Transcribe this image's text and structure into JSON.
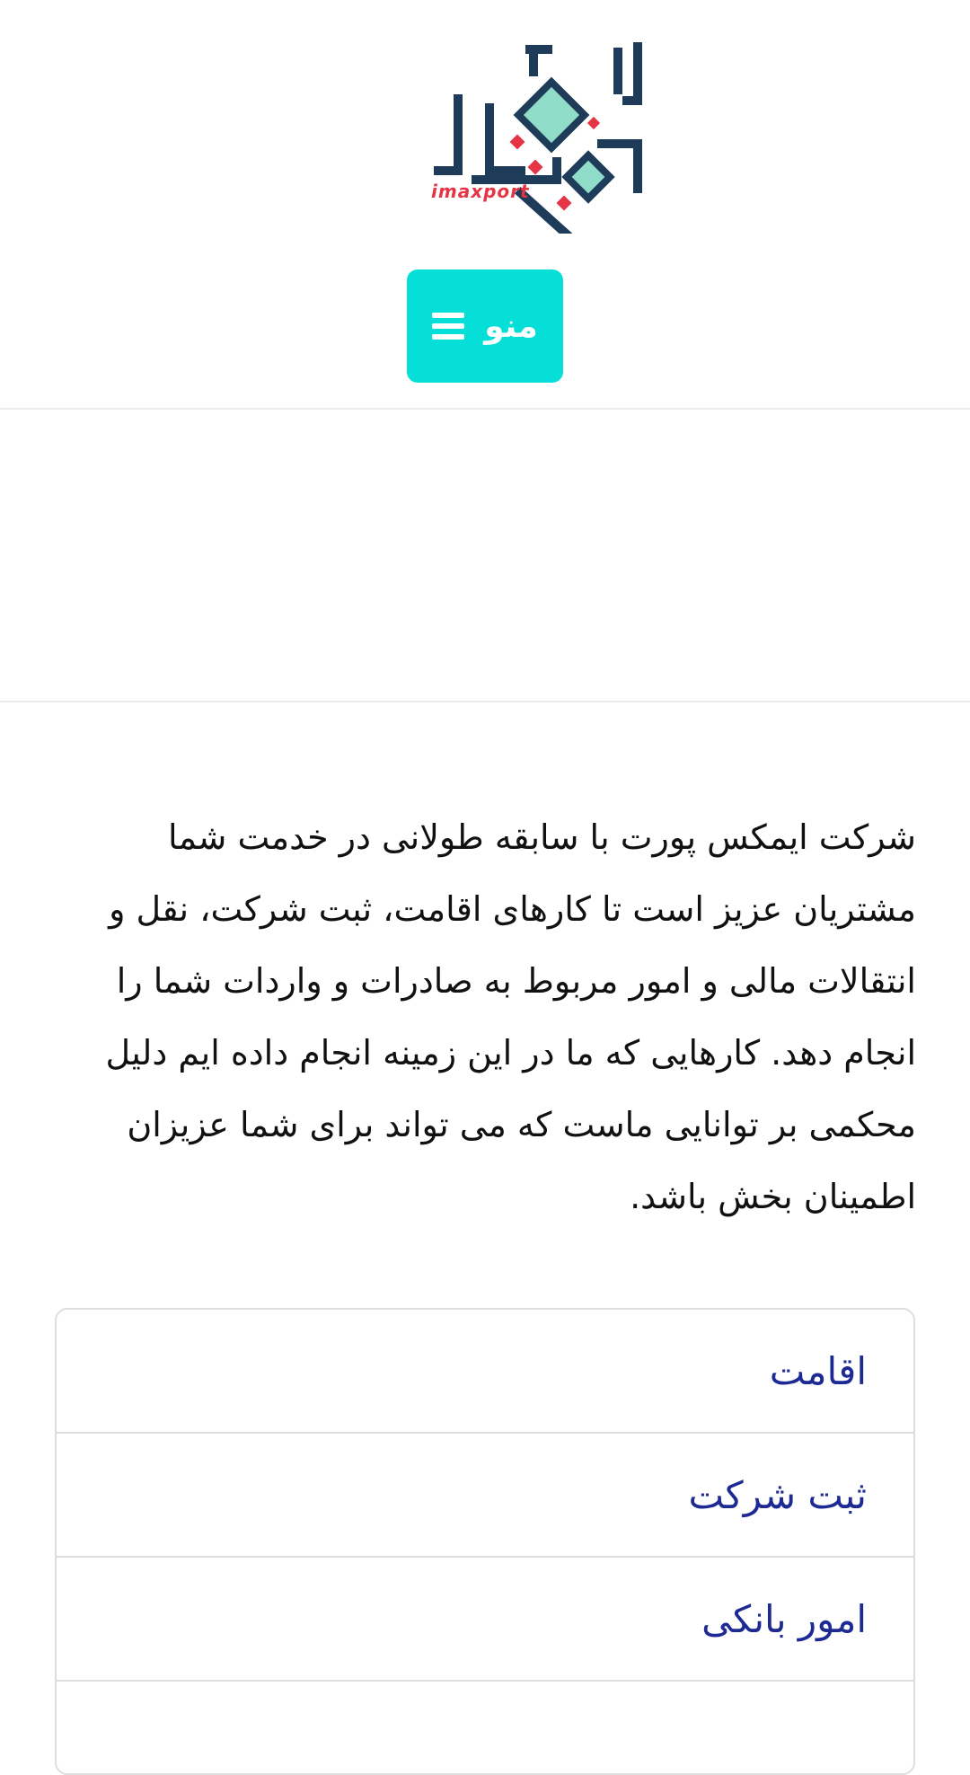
{
  "header": {
    "logo_caption": "imaxport",
    "menu_label": "منو"
  },
  "intro": {
    "text": "شرکت ایمکس پورت با سابقه طولانی در خدمت شما مشتریان عزیز است تا کارهای اقامت، ثبت شرکت، نقل و انتقالات مالی و امور مربوط به صادرات و واردات شما را انجام دهد. کارهایی که ما در این زمینه انجام داده ایم دلیل محکمی بر توانایی ماست که می تواند برای شما عزیزان اطمینان بخش باشد."
  },
  "services": {
    "items": [
      {
        "label": "اقامت"
      },
      {
        "label": "ثبت شرکت"
      },
      {
        "label": "امور بانکی"
      },
      {
        "label": ""
      }
    ]
  },
  "colors": {
    "menu_button": "#05dfd7",
    "link_text": "#1e2a94",
    "logo_navy": "#1f3b5a",
    "logo_mint": "#8fdcc8",
    "logo_red": "#e53545"
  },
  "icons": {
    "menu": "hamburger-icon"
  }
}
